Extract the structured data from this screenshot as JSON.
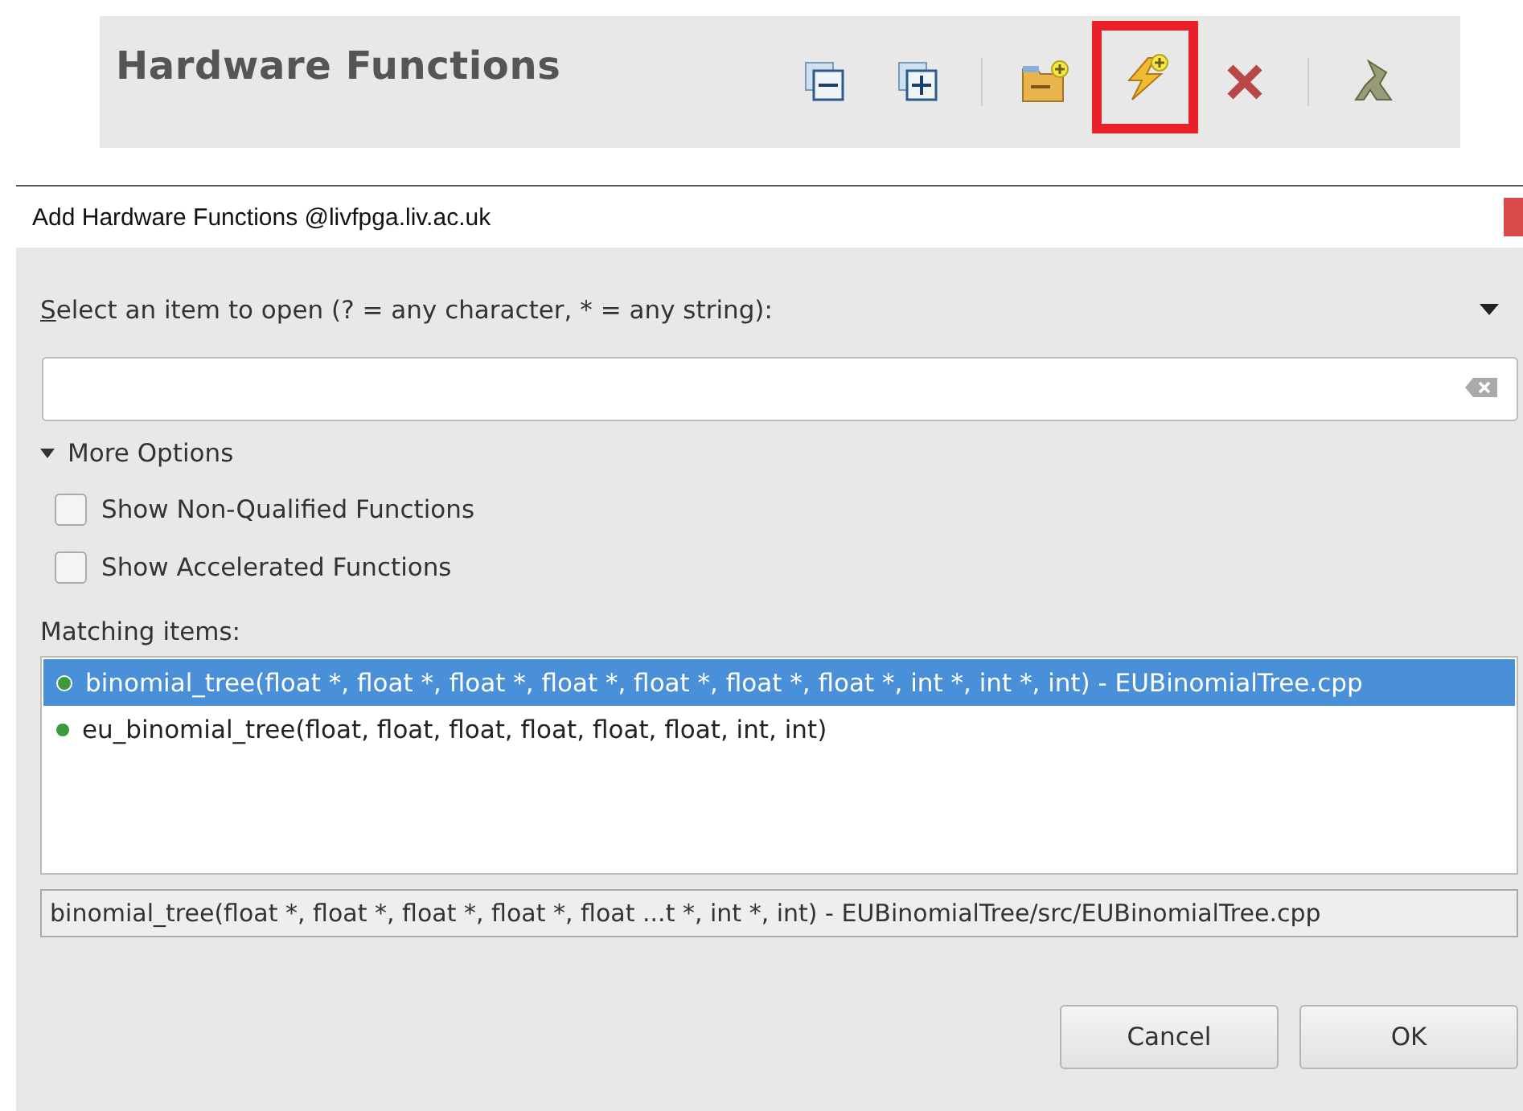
{
  "view": {
    "title": "Hardware Functions",
    "tools": [
      {
        "kind": "collapse",
        "highlighted": false
      },
      {
        "kind": "expand",
        "highlighted": false
      },
      {
        "kind": "separator",
        "highlighted": false
      },
      {
        "kind": "folder-add",
        "highlighted": false
      },
      {
        "kind": "bolt-add",
        "highlighted": true
      },
      {
        "kind": "delete",
        "highlighted": false
      },
      {
        "kind": "separator",
        "highlighted": false
      },
      {
        "kind": "logo",
        "highlighted": false
      }
    ]
  },
  "dialog": {
    "title": "Add Hardware Functions @livfpga.liv.ac.uk",
    "prompt": "Select an item to open (? = any character, * = any string):",
    "more_options": {
      "label": "More Options",
      "expanded": true
    },
    "options": [
      {
        "label": "Show Non-Qualified Functions",
        "checked": false
      },
      {
        "label": "Show Accelerated Functions",
        "checked": false
      }
    ],
    "matching_label": "Matching items:",
    "items": [
      {
        "label": "binomial_tree(float *, float *, float *, float *, float *, float *, float *, int *, int *, int) - EUBinomialTree.cpp",
        "selected": true
      },
      {
        "label": "eu_binomial_tree(float, float, float, float, float, float, int, int)",
        "selected": false
      }
    ],
    "status": "binomial_tree(float *, float *, float *, float *, float ...t *, int *, int) - EUBinomialTree/src/EUBinomialTree.cpp",
    "buttons": [
      "Cancel",
      "OK"
    ]
  }
}
